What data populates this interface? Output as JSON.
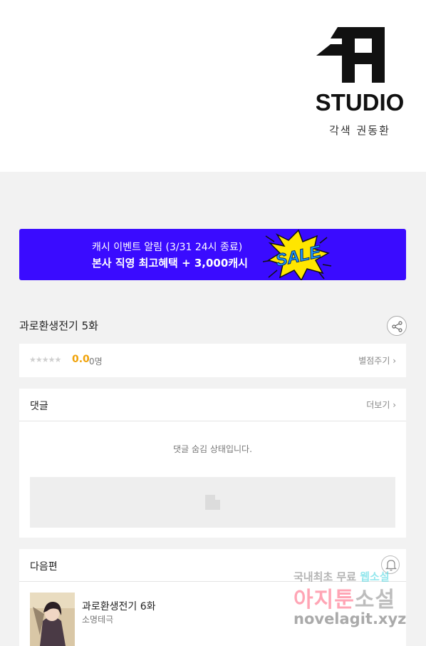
{
  "header": {
    "logo_text": "STUDIO",
    "credit": "각색 권동환"
  },
  "banner": {
    "line1": "캐시 이벤트 알림 (3/31 24시 종료)",
    "line2": "본사 직영 최고혜택 + 3,000캐시",
    "sale_text": "SALE",
    "bg_color": "#3a0bff"
  },
  "episode": {
    "title": "과로환생전기 5화",
    "share_icon": "share-icon"
  },
  "rating": {
    "stars": "★★★★★",
    "score": "0.0",
    "votes": "0명",
    "rate_link": "별점주기 ›",
    "score_color": "#f0a30a"
  },
  "comments": {
    "title": "댓글",
    "more": "더보기 ›",
    "hidden_message": "댓글 숨김 상태입니다."
  },
  "next": {
    "title": "다음편",
    "episode_title": "과로환생전기 6화",
    "author": "소명테극",
    "bell_icon": "bell-icon"
  },
  "watermark": {
    "line1_a": "국내최초 무료 ",
    "line1_b": "웹소설",
    "line2_a": "아지툰",
    "line2_b": "소설",
    "line3": "novelagit.xyz"
  }
}
